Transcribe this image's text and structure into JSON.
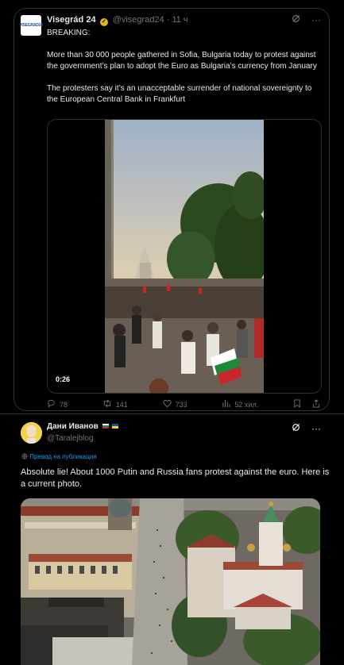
{
  "quoted": {
    "author_name": "Visegrád 24",
    "avatar_text": "VISEGRAD24",
    "handle": "@visegrad24",
    "time": " · 11 ч",
    "paragraphs": [
      "BREAKING:",
      "More than 30 000 people gathered in Sofia, Bulgaria today to protest against the government’s plan to adopt the Euro as Bulgaria’s currency from January",
      "The protesters say it’s an unacceptable surrender of national sovereignty to the European Central Bank in Frankfurt"
    ],
    "video_duration": "0:26",
    "actions": {
      "replies": "78",
      "reposts": "141",
      "likes": "733",
      "views": "52 хил."
    }
  },
  "reply": {
    "author_name": "Дани Иванов",
    "handle": "@Taralejblog",
    "translate_label": "Превод на публикация",
    "text": "Absolute lie! About 1000 Putin and Russia fans protest against the euro. Here is a current photo."
  },
  "icons": {
    "grok": "grok-icon",
    "more": "more-icon",
    "reply": "reply-icon",
    "repost": "repost-icon",
    "like": "heart-icon",
    "views": "views-icon",
    "bookmark": "bookmark-icon",
    "share": "share-icon",
    "globe": "globe-icon"
  },
  "colors": {
    "background": "#000000",
    "border": "#2f3336",
    "muted": "#71767b",
    "link": "#1d9bf0",
    "verified": "#e2b719"
  }
}
